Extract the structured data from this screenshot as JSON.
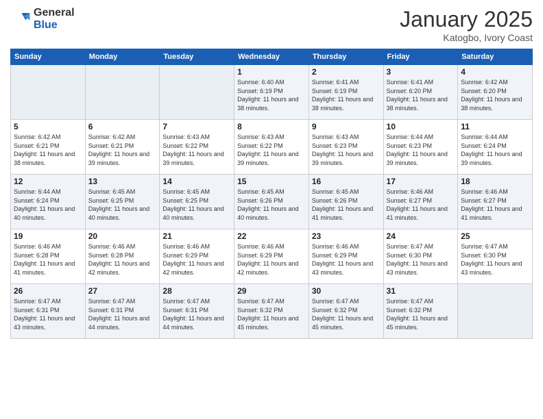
{
  "logo": {
    "general": "General",
    "blue": "Blue"
  },
  "header": {
    "month": "January 2025",
    "location": "Katogbo, Ivory Coast"
  },
  "weekdays": [
    "Sunday",
    "Monday",
    "Tuesday",
    "Wednesday",
    "Thursday",
    "Friday",
    "Saturday"
  ],
  "weeks": [
    [
      {
        "day": "",
        "sunrise": "",
        "sunset": "",
        "daylight": "",
        "empty": true
      },
      {
        "day": "",
        "sunrise": "",
        "sunset": "",
        "daylight": "",
        "empty": true
      },
      {
        "day": "",
        "sunrise": "",
        "sunset": "",
        "daylight": "",
        "empty": true
      },
      {
        "day": "1",
        "sunrise": "Sunrise: 6:40 AM",
        "sunset": "Sunset: 6:19 PM",
        "daylight": "Daylight: 11 hours and 38 minutes."
      },
      {
        "day": "2",
        "sunrise": "Sunrise: 6:41 AM",
        "sunset": "Sunset: 6:19 PM",
        "daylight": "Daylight: 11 hours and 38 minutes."
      },
      {
        "day": "3",
        "sunrise": "Sunrise: 6:41 AM",
        "sunset": "Sunset: 6:20 PM",
        "daylight": "Daylight: 11 hours and 38 minutes."
      },
      {
        "day": "4",
        "sunrise": "Sunrise: 6:42 AM",
        "sunset": "Sunset: 6:20 PM",
        "daylight": "Daylight: 11 hours and 38 minutes."
      }
    ],
    [
      {
        "day": "5",
        "sunrise": "Sunrise: 6:42 AM",
        "sunset": "Sunset: 6:21 PM",
        "daylight": "Daylight: 11 hours and 38 minutes."
      },
      {
        "day": "6",
        "sunrise": "Sunrise: 6:42 AM",
        "sunset": "Sunset: 6:21 PM",
        "daylight": "Daylight: 11 hours and 39 minutes."
      },
      {
        "day": "7",
        "sunrise": "Sunrise: 6:43 AM",
        "sunset": "Sunset: 6:22 PM",
        "daylight": "Daylight: 11 hours and 39 minutes."
      },
      {
        "day": "8",
        "sunrise": "Sunrise: 6:43 AM",
        "sunset": "Sunset: 6:22 PM",
        "daylight": "Daylight: 11 hours and 39 minutes."
      },
      {
        "day": "9",
        "sunrise": "Sunrise: 6:43 AM",
        "sunset": "Sunset: 6:23 PM",
        "daylight": "Daylight: 11 hours and 39 minutes."
      },
      {
        "day": "10",
        "sunrise": "Sunrise: 6:44 AM",
        "sunset": "Sunset: 6:23 PM",
        "daylight": "Daylight: 11 hours and 39 minutes."
      },
      {
        "day": "11",
        "sunrise": "Sunrise: 6:44 AM",
        "sunset": "Sunset: 6:24 PM",
        "daylight": "Daylight: 11 hours and 39 minutes."
      }
    ],
    [
      {
        "day": "12",
        "sunrise": "Sunrise: 6:44 AM",
        "sunset": "Sunset: 6:24 PM",
        "daylight": "Daylight: 11 hours and 40 minutes."
      },
      {
        "day": "13",
        "sunrise": "Sunrise: 6:45 AM",
        "sunset": "Sunset: 6:25 PM",
        "daylight": "Daylight: 11 hours and 40 minutes."
      },
      {
        "day": "14",
        "sunrise": "Sunrise: 6:45 AM",
        "sunset": "Sunset: 6:25 PM",
        "daylight": "Daylight: 11 hours and 40 minutes."
      },
      {
        "day": "15",
        "sunrise": "Sunrise: 6:45 AM",
        "sunset": "Sunset: 6:26 PM",
        "daylight": "Daylight: 11 hours and 40 minutes."
      },
      {
        "day": "16",
        "sunrise": "Sunrise: 6:45 AM",
        "sunset": "Sunset: 6:26 PM",
        "daylight": "Daylight: 11 hours and 41 minutes."
      },
      {
        "day": "17",
        "sunrise": "Sunrise: 6:46 AM",
        "sunset": "Sunset: 6:27 PM",
        "daylight": "Daylight: 11 hours and 41 minutes."
      },
      {
        "day": "18",
        "sunrise": "Sunrise: 6:46 AM",
        "sunset": "Sunset: 6:27 PM",
        "daylight": "Daylight: 11 hours and 41 minutes."
      }
    ],
    [
      {
        "day": "19",
        "sunrise": "Sunrise: 6:46 AM",
        "sunset": "Sunset: 6:28 PM",
        "daylight": "Daylight: 11 hours and 41 minutes."
      },
      {
        "day": "20",
        "sunrise": "Sunrise: 6:46 AM",
        "sunset": "Sunset: 6:28 PM",
        "daylight": "Daylight: 11 hours and 42 minutes."
      },
      {
        "day": "21",
        "sunrise": "Sunrise: 6:46 AM",
        "sunset": "Sunset: 6:29 PM",
        "daylight": "Daylight: 11 hours and 42 minutes."
      },
      {
        "day": "22",
        "sunrise": "Sunrise: 6:46 AM",
        "sunset": "Sunset: 6:29 PM",
        "daylight": "Daylight: 11 hours and 42 minutes."
      },
      {
        "day": "23",
        "sunrise": "Sunrise: 6:46 AM",
        "sunset": "Sunset: 6:29 PM",
        "daylight": "Daylight: 11 hours and 43 minutes."
      },
      {
        "day": "24",
        "sunrise": "Sunrise: 6:47 AM",
        "sunset": "Sunset: 6:30 PM",
        "daylight": "Daylight: 11 hours and 43 minutes."
      },
      {
        "day": "25",
        "sunrise": "Sunrise: 6:47 AM",
        "sunset": "Sunset: 6:30 PM",
        "daylight": "Daylight: 11 hours and 43 minutes."
      }
    ],
    [
      {
        "day": "26",
        "sunrise": "Sunrise: 6:47 AM",
        "sunset": "Sunset: 6:31 PM",
        "daylight": "Daylight: 11 hours and 43 minutes."
      },
      {
        "day": "27",
        "sunrise": "Sunrise: 6:47 AM",
        "sunset": "Sunset: 6:31 PM",
        "daylight": "Daylight: 11 hours and 44 minutes."
      },
      {
        "day": "28",
        "sunrise": "Sunrise: 6:47 AM",
        "sunset": "Sunset: 6:31 PM",
        "daylight": "Daylight: 11 hours and 44 minutes."
      },
      {
        "day": "29",
        "sunrise": "Sunrise: 6:47 AM",
        "sunset": "Sunset: 6:32 PM",
        "daylight": "Daylight: 11 hours and 45 minutes."
      },
      {
        "day": "30",
        "sunrise": "Sunrise: 6:47 AM",
        "sunset": "Sunset: 6:32 PM",
        "daylight": "Daylight: 11 hours and 45 minutes."
      },
      {
        "day": "31",
        "sunrise": "Sunrise: 6:47 AM",
        "sunset": "Sunset: 6:32 PM",
        "daylight": "Daylight: 11 hours and 45 minutes."
      },
      {
        "day": "",
        "sunrise": "",
        "sunset": "",
        "daylight": "",
        "empty": true
      }
    ]
  ]
}
